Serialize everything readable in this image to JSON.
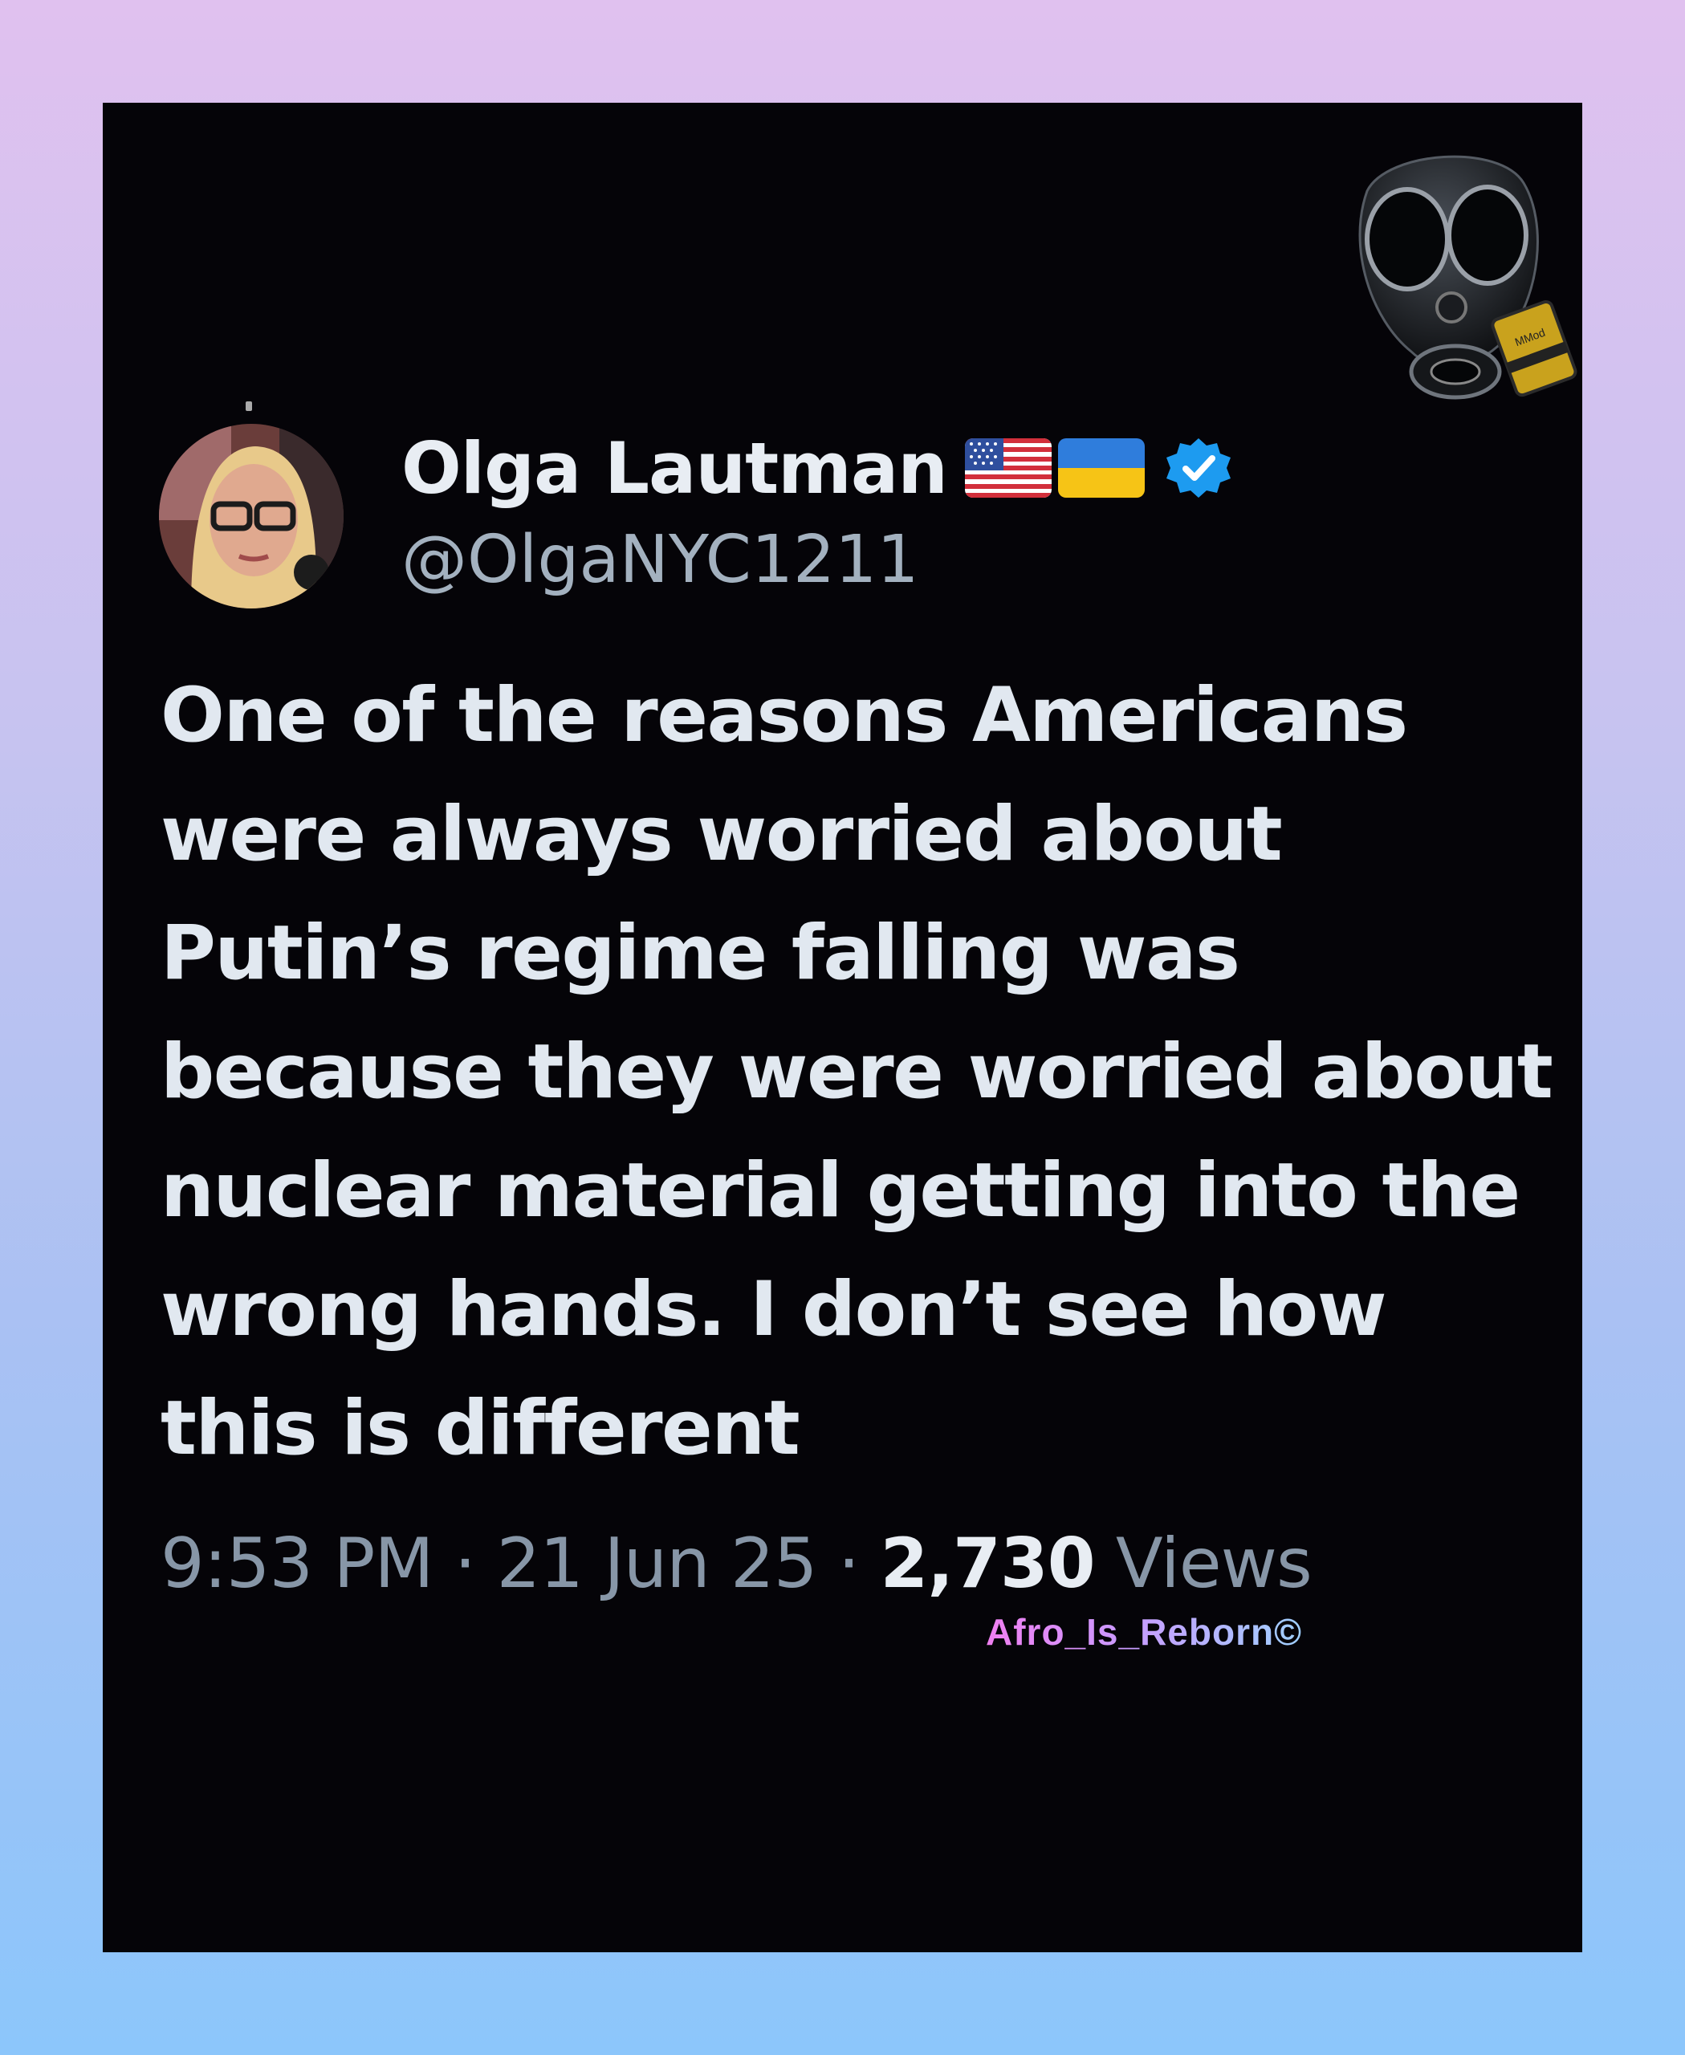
{
  "tweet": {
    "display_name": "Olga Lautman",
    "handle": "@OlgaNYC1211",
    "flags": [
      "us-flag-icon",
      "ukraine-flag-icon"
    ],
    "verified": true,
    "text": "One of the reasons Americans were always worried about Putin’s regime falling was because they were worried about nuclear material getting into the wrong hands. I don’t see how this is different",
    "time": "9:53 PM",
    "date": "21 Jun 25",
    "separator": "·",
    "views_count": "2,730",
    "views_label": "Views"
  },
  "decorations": {
    "watermark": "Afro_Is_Reborn©",
    "mask_icon": "gas-mask-icon",
    "canister_label": "MMod"
  },
  "colors": {
    "card_bg": "#050408",
    "name": "#e8edf3",
    "secondary": "#8796a7",
    "verified": "#1d9bf0",
    "watermark_start": "#f07ff0",
    "watermark_end": "#9fd0ff"
  }
}
